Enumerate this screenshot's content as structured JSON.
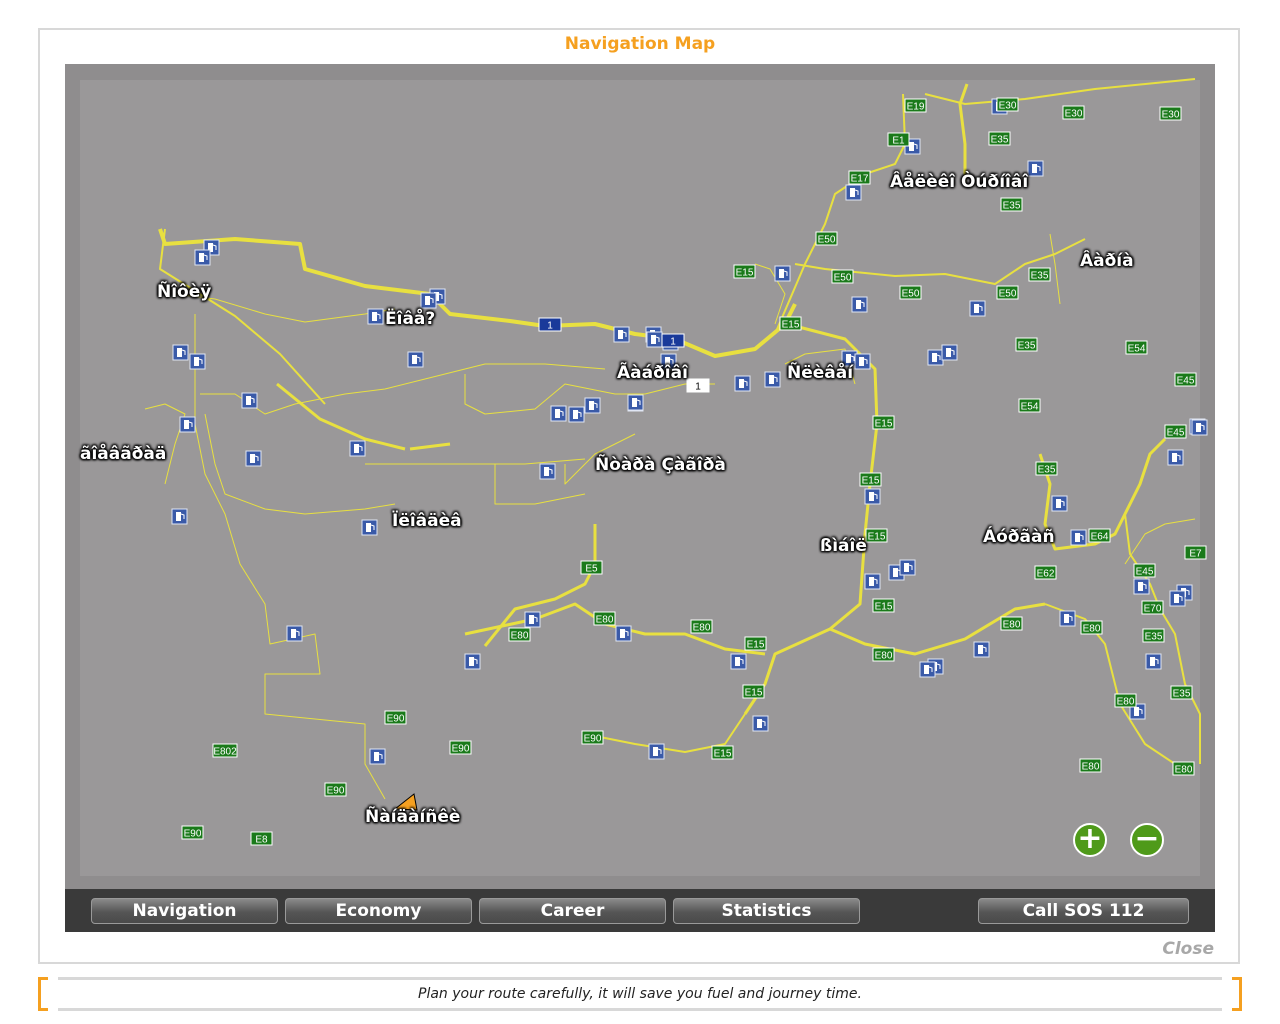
{
  "window": {
    "title": "Navigation Map",
    "close_label": "Close"
  },
  "tip": "Plan your route carefully, it will save you fuel and journey time.",
  "tabs": [
    {
      "label": "Navigation"
    },
    {
      "label": "Economy"
    },
    {
      "label": "Career"
    },
    {
      "label": "Statistics"
    }
  ],
  "sos_label": "Call SOS 112",
  "zoom": {
    "in_icon": "plus-icon",
    "out_icon": "minus-icon"
  },
  "colors": {
    "accent": "#f5a020",
    "road": "#e8e040",
    "map_bg": "#8f8d8e",
    "shield_e": "#1a7a1a",
    "shield_national": "#1a3a9a",
    "fuel": "#3a5aa8"
  },
  "cities": [
    {
      "name": "Âåëèêî Òúðíîâî"
    },
    {
      "name": "Âàðíà"
    },
    {
      "name": "Ñîôèÿ"
    },
    {
      "name": "Ëîâå?"
    },
    {
      "name": "Ãàáðîâî"
    },
    {
      "name": "Ñëèâåí"
    },
    {
      "name": "ãîåâãðàä"
    },
    {
      "name": "Ñòàðà Çàãîðà"
    },
    {
      "name": "Ïëîâäèâ"
    },
    {
      "name": "ßìáîë"
    },
    {
      "name": "Áóðãàñ"
    },
    {
      "name": "Ñàíäàíñêè"
    }
  ],
  "shields": [
    "E19",
    "E30",
    "E30",
    "E30",
    "E1",
    "E35",
    "E17",
    "E35",
    "E50",
    "E15",
    "E50",
    "E50",
    "E50",
    "E35",
    "1",
    "1",
    "E15",
    "1",
    "E35",
    "E54",
    "E45",
    "E54",
    "E45",
    "E15",
    "E15",
    "E35",
    "E15",
    "E64",
    "E7",
    "E5",
    "E62",
    "E45",
    "E70",
    "E80",
    "E80",
    "E80",
    "E15",
    "E15",
    "E80",
    "E80",
    "E80",
    "E35",
    "E15",
    "E35",
    "E80",
    "E80",
    "E802",
    "E90",
    "E90",
    "E15",
    "E90",
    "E90",
    "E90",
    "E8",
    "E80"
  ],
  "player": {
    "icon": "player-truck-arrow-icon"
  }
}
